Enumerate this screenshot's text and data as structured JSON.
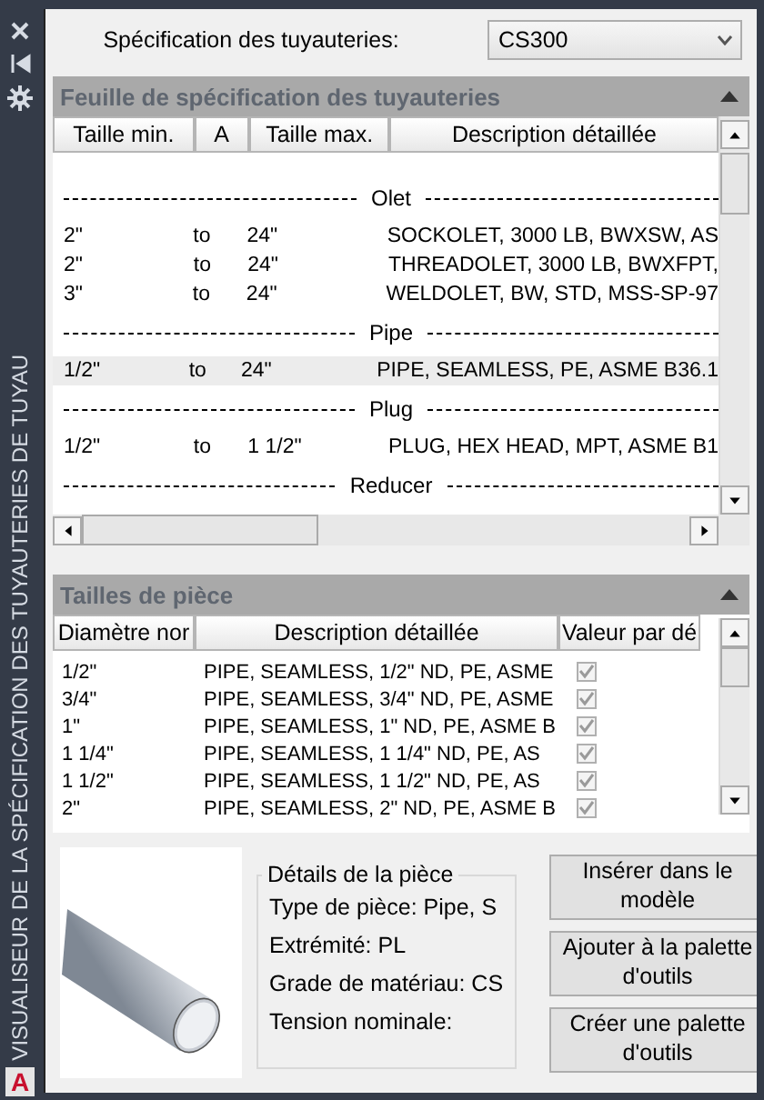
{
  "window": {
    "side_title": "VISUALISEUR DE LA SPÉCIFICATION DES TUYAUTERIES DE TUYAU",
    "logo": "A"
  },
  "spec": {
    "label": "Spécification des tuyauteries:",
    "value": "CS300"
  },
  "spec_sheet": {
    "title": "Feuille de spécification des tuyauteries",
    "expanded": true,
    "columns": [
      "Taille min.",
      "A",
      "Taille max.",
      "Description détaillée"
    ],
    "rows": [
      {
        "kind": "group",
        "label": "Olet"
      },
      {
        "kind": "item",
        "min": "2\"",
        "a": "to",
        "max": "24\"",
        "description": "SOCKOLET, 3000 LB, BWXSW, AS",
        "selected": false
      },
      {
        "kind": "item",
        "min": "2\"",
        "a": "to",
        "max": "24\"",
        "description": "THREADOLET, 3000 LB, BWXFPT,",
        "selected": false
      },
      {
        "kind": "item",
        "min": "3\"",
        "a": "to",
        "max": "24\"",
        "description": "WELDOLET, BW, STD, MSS-SP-97",
        "selected": false
      },
      {
        "kind": "group",
        "label": "Pipe"
      },
      {
        "kind": "item",
        "min": "1/2\"",
        "a": "to",
        "max": "24\"",
        "description": "PIPE, SEAMLESS, PE, ASME B36.1",
        "selected": true
      },
      {
        "kind": "group",
        "label": "Plug"
      },
      {
        "kind": "item",
        "min": "1/2\"",
        "a": "to",
        "max": "1 1/2\"",
        "description": "PLUG, HEX HEAD, MPT, ASME B1",
        "selected": false
      },
      {
        "kind": "group",
        "label": "Reducer"
      }
    ]
  },
  "sizes": {
    "title": "Tailles de pièce",
    "expanded": true,
    "columns": [
      "Diamètre nor",
      "Description détaillée",
      "Valeur par dé"
    ],
    "rows": [
      {
        "size": "1/2\"",
        "description": "PIPE, SEAMLESS, 1/2\" ND, PE, ASME",
        "default": true
      },
      {
        "size": "3/4\"",
        "description": "PIPE, SEAMLESS, 3/4\" ND, PE, ASME",
        "default": true
      },
      {
        "size": "1\"",
        "description": "PIPE, SEAMLESS, 1\" ND, PE, ASME B",
        "default": true
      },
      {
        "size": "1 1/4\"",
        "description": "PIPE, SEAMLESS, 1 1/4\" ND, PE, AS",
        "default": true
      },
      {
        "size": "1 1/2\"",
        "description": "PIPE, SEAMLESS, 1 1/2\" ND, PE, AS",
        "default": true
      },
      {
        "size": "2\"",
        "description": "PIPE, SEAMLESS, 2\" ND, PE, ASME B",
        "default": true
      }
    ]
  },
  "details": {
    "title": "Détails de la pièce",
    "lines": [
      "Type de pièce: Pipe, S",
      "Extrémité: PL",
      "Grade de matériau: CS",
      "Tension nominale:"
    ]
  },
  "buttons": [
    "Insérer dans le modèle",
    "Ajouter à la palette d'outils",
    "Créer une palette d'outils"
  ]
}
